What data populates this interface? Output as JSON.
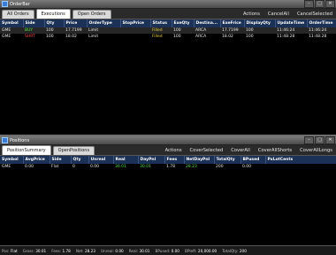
{
  "orders_window": {
    "title": "OrderBar",
    "tabs": [
      "All Orders",
      "Executions",
      "Open Orders"
    ],
    "active_tab": "Executions",
    "actions": [
      "Actions",
      "CancelAll",
      "CancelSelected"
    ],
    "columns": [
      "Symbol",
      "Side",
      "Qty",
      "Price",
      "OrderType",
      "StopPrice",
      "Status",
      "ExeQty",
      "Destina...",
      "ExeFrice",
      "DisplayQty",
      "UpdateTime",
      "OrderTime"
    ],
    "rows": [
      [
        "GME",
        "BUY",
        "100",
        "17.7199",
        "Limit",
        "",
        "Filled",
        "100",
        "ARCA",
        "17.7199",
        "100",
        "11:46:24",
        "11:46:24"
      ],
      [
        "GME",
        "SHRT",
        "100",
        "18.02",
        "Limit",
        "",
        "Filled",
        "100",
        "ARCA",
        "18.02",
        "100",
        "11:48:28",
        "11:48:28"
      ]
    ]
  },
  "positions_window": {
    "title": "Positions",
    "tabs": [
      "PositionSummary",
      "OpenPositions"
    ],
    "active_tab": "PositionSummary",
    "actions": [
      "Actions",
      "CoverSelected",
      "CoverAll",
      "CoverAllShorts",
      "CoverAllLongs"
    ],
    "columns": [
      "Symbol",
      "AvgPrice",
      "Side",
      "Qty",
      "Unreal",
      "Real",
      "DayPnl",
      "Fees",
      "NetDayPnl",
      "TotalQty",
      "BPused",
      "PxLotCents"
    ],
    "rows": [
      [
        "GME",
        "0.00",
        "Flat",
        "0",
        "0.00",
        "30.01",
        "30.01",
        "1.78",
        "28.23",
        "200",
        "0.00",
        ""
      ]
    ]
  },
  "status_bar": [
    {
      "label": "Pos:",
      "value": "Flat"
    },
    {
      "label": "Gross:",
      "value": "30.01"
    },
    {
      "label": "Fees:",
      "value": "1.78"
    },
    {
      "label": "Net:",
      "value": "28.23"
    },
    {
      "label": "Unreal:",
      "value": "0.00"
    },
    {
      "label": "Real:",
      "value": "30.01"
    },
    {
      "label": "BPused:",
      "value": "0.00"
    },
    {
      "label": "BPleft:",
      "value": "20,000.00"
    },
    {
      "label": "TotalQty:",
      "value": "200"
    }
  ],
  "colors": {
    "header_bg": "#1c3156",
    "buy": "#54e644",
    "sell": "#ff4a4a",
    "filled": "#e8d240"
  }
}
